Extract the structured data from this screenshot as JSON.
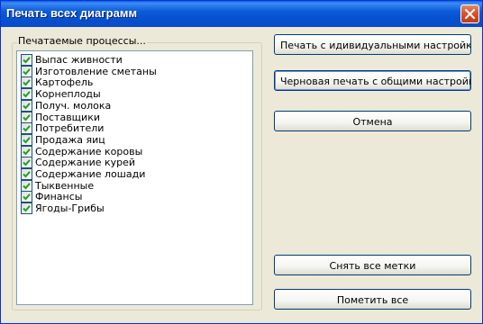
{
  "window": {
    "title": "Печать всех диаграмм"
  },
  "group": {
    "label": "Печатаемые процессы...",
    "items": [
      {
        "label": "Выпас живности",
        "checked": true
      },
      {
        "label": "Изготовление сметаны",
        "checked": true
      },
      {
        "label": "Картофель",
        "checked": true
      },
      {
        "label": "Корнеплоды",
        "checked": true
      },
      {
        "label": "Получ. молока",
        "checked": true
      },
      {
        "label": "Поставщики",
        "checked": true
      },
      {
        "label": "Потребители",
        "checked": true
      },
      {
        "label": "Продажа яиц",
        "checked": true
      },
      {
        "label": "Содержание коровы",
        "checked": true
      },
      {
        "label": "Содержание курей",
        "checked": true
      },
      {
        "label": "Содержание лошади",
        "checked": true
      },
      {
        "label": "Тыквенные",
        "checked": true
      },
      {
        "label": "Финансы",
        "checked": true
      },
      {
        "label": "Ягоды-Грибы",
        "checked": true
      }
    ]
  },
  "buttons": {
    "print_individual": "Печать с идивидуальными настройками",
    "draft_print": "Черновая печать с общими настройками",
    "cancel": "Отмена",
    "uncheck_all": "Снять все метки",
    "check_all": "Пометить все"
  },
  "icons": {
    "close": "close-icon",
    "check": "checkmark-icon"
  },
  "colors": {
    "titlebar": "#0a5fe6",
    "close": "#d8542e",
    "check": "#21a121",
    "dialog_bg": "#ece9d8"
  }
}
